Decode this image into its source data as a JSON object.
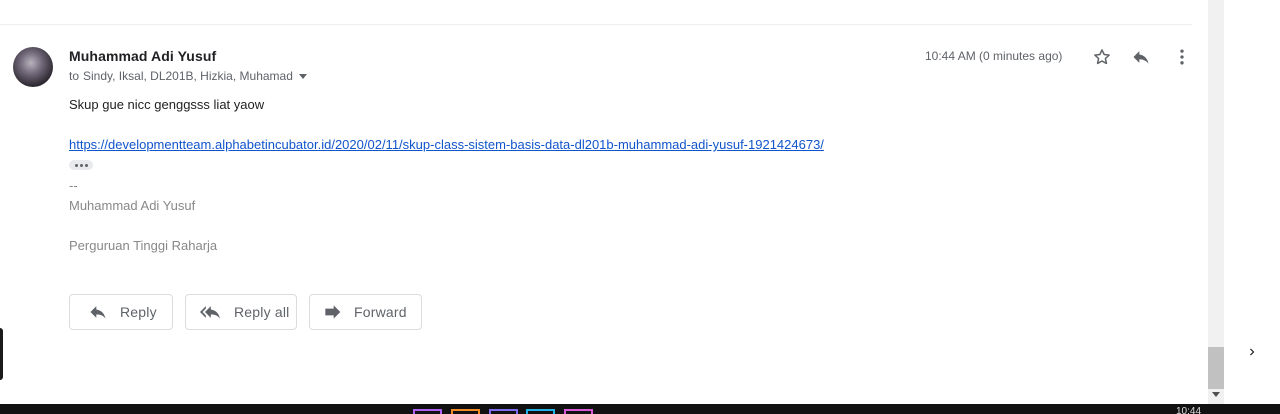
{
  "email": {
    "sender": "Muhammad Adi Yusuf",
    "to_label": "to",
    "recipients": "Sindy, Iksal, DL201B, Hizkia, Muhamad",
    "timestamp": "10:44 AM (0 minutes ago)",
    "body": "Skup gue nicc genggsss liat yaow",
    "link": "https://developmentteam.alphabetincubator.id/2020/02/11/skup-class-sistem-basis-data-dl201b-muhammad-adi-yusuf-1921424673/",
    "signature_dash": "--",
    "signature_name": "Muhammad Adi Yusuf",
    "signature_org": "Perguruan Tinggi Raharja"
  },
  "actions": {
    "reply": "Reply",
    "reply_all": "Reply all",
    "forward": "Forward"
  },
  "icons": {
    "star": "star-icon",
    "reply": "reply-icon",
    "more": "more-vert-icon",
    "next": "chevron-right-icon"
  },
  "taskbar": {
    "clock": "10:44"
  }
}
